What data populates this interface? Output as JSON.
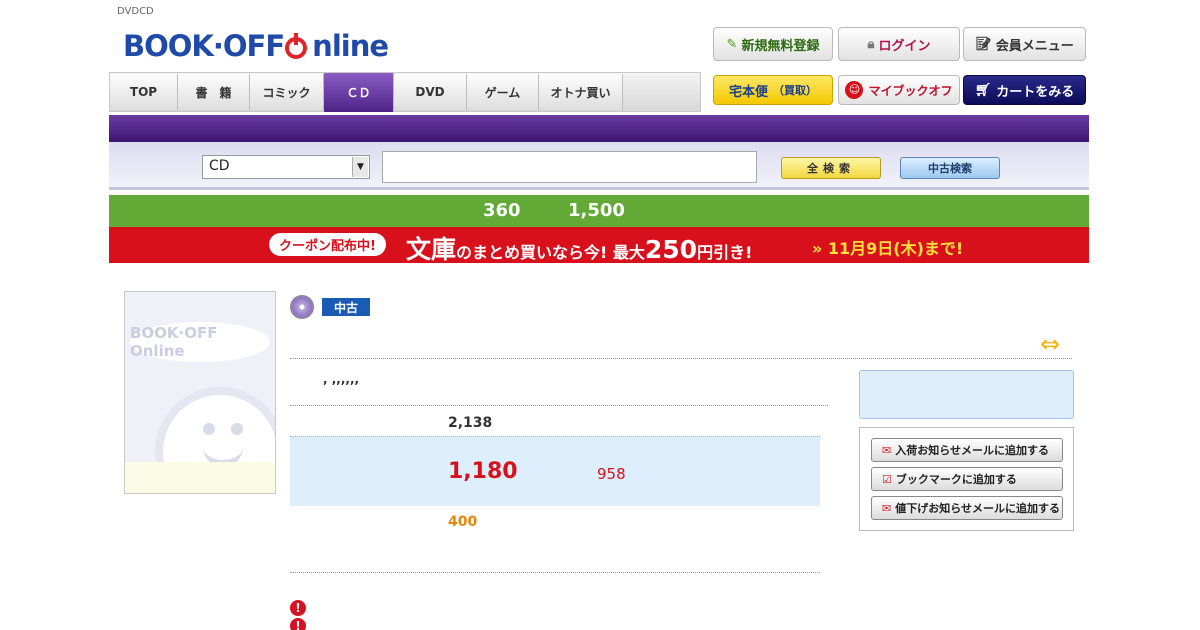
{
  "breadcrumb": "DVDCD",
  "logo": {
    "text": "BOOK·OFF Online"
  },
  "header_buttons": {
    "register": "新規無料登録",
    "login": "ログイン",
    "member_menu": "会員メニュー"
  },
  "nav": {
    "tabs": [
      {
        "label": "TOP"
      },
      {
        "label": "書　籍"
      },
      {
        "label": "コミック"
      },
      {
        "label": "ＣＤ",
        "active": true
      },
      {
        "label": "DVD"
      },
      {
        "label": "ゲーム"
      },
      {
        "label": "オトナ買い"
      }
    ]
  },
  "right_buttons": {
    "takuhaibin": "宅本便",
    "kaitori": "（買取）",
    "mybookoff": "マイブックオフ",
    "cart": "カートをみる"
  },
  "search": {
    "category": "CD",
    "query": "",
    "all_search": "全検索",
    "used_search": "中古検索"
  },
  "green_banner": {
    "left_value": "360",
    "right_value": "1,500"
  },
  "red_banner": {
    "coupon": "クーポン配布中!",
    "part1": "文庫",
    "part2": "のまとめ買いなら今! 最大",
    "amount": "250",
    "part3": "円引き!",
    "until": "» 11月9日(木)まで!"
  },
  "product": {
    "condition_badge": "中古",
    "title": ", ,,,,,,",
    "list_price": "2,138",
    "sale_price": "1,180",
    "sale_sub": "958",
    "points": "400",
    "thumb_logo": "BOOK·OFF Online"
  },
  "actions": {
    "arrival_mail": "入荷お知らせメールに追加する",
    "bookmark": "ブックマークに追加する",
    "price_drop_mail": "値下げお知らせメールに追加する"
  },
  "colors": {
    "brand_purple": "#4d2386",
    "banner_green": "#62a935",
    "banner_red": "#d8101c",
    "price_red": "#d8101c",
    "point_orange": "#e8860a"
  }
}
